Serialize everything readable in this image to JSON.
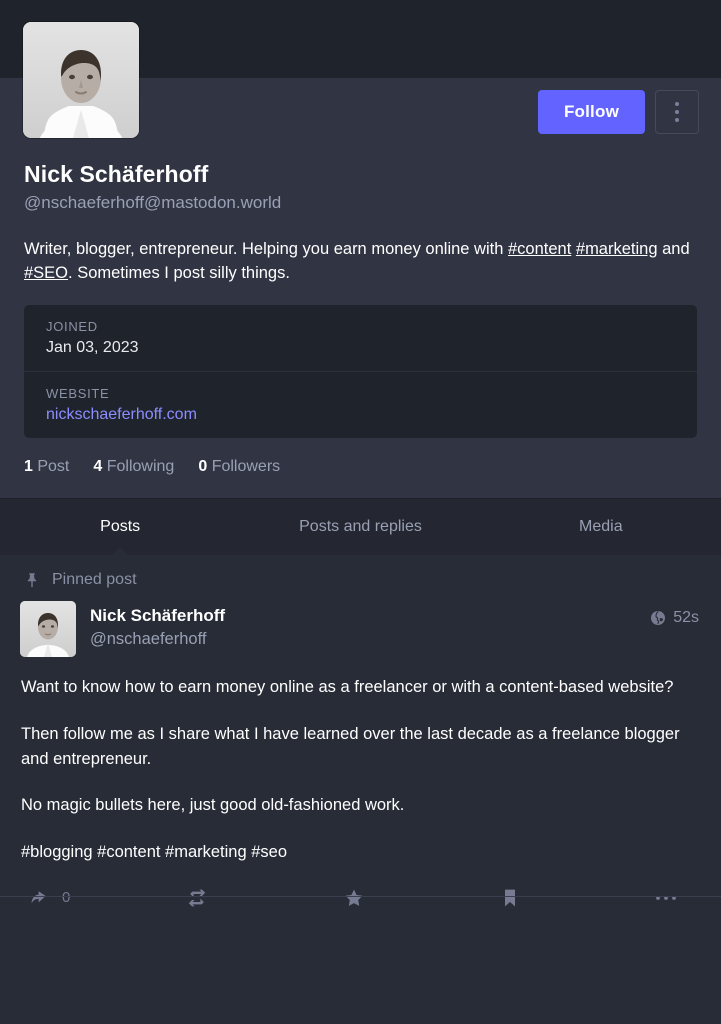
{
  "profile": {
    "avatar_alt": "profile-avatar",
    "display_name": "Nick Schäferhoff",
    "handle": "@nschaeferhoff@mastodon.world",
    "follow_label": "Follow",
    "menu_icon": "kebab-menu-icon",
    "bio_parts": [
      {
        "type": "text",
        "text": "Writer, blogger, entrepreneur. Helping you earn money online with "
      },
      {
        "type": "link",
        "text": "#content"
      },
      {
        "type": "text",
        "text": " "
      },
      {
        "type": "link",
        "text": "#marketing"
      },
      {
        "type": "text",
        "text": " and "
      },
      {
        "type": "link",
        "text": "#SEO"
      },
      {
        "type": "text",
        "text": ". Sometimes I post silly things."
      }
    ],
    "bio_plain": "Writer, blogger, entrepreneur. Helping you earn money online with #content #marketing and #SEO. Sometimes I post silly things.",
    "metadata": [
      {
        "label": "JOINED",
        "value": "Jan 03, 2023",
        "is_link": false
      },
      {
        "label": "WEBSITE",
        "value": "nickschaeferhoff.com",
        "is_link": true
      }
    ],
    "stats": [
      {
        "count": "1",
        "label": "Post"
      },
      {
        "count": "4",
        "label": "Following"
      },
      {
        "count": "0",
        "label": "Followers"
      }
    ],
    "accent_color": "#6364ff",
    "link_color": "#8c8dff"
  },
  "tabs": [
    {
      "label": "Posts",
      "active": true
    },
    {
      "label": "Posts and replies",
      "active": false
    },
    {
      "label": "Media",
      "active": false
    }
  ],
  "status": {
    "pinned_label": "Pinned post",
    "pin_icon": "pin-icon",
    "author_name": "Nick Schäferhoff",
    "author_handle": "@nschaeferhoff",
    "visibility_icon": "globe-icon",
    "timestamp": "52s",
    "paragraphs": [
      "Want to know how to earn money online as a freelancer or with a content-based website?",
      "Then follow me as I share what I have learned over the last decade as a freelance blogger and entrepreneur.",
      "No magic bullets here, just good old-fashioned work.",
      "#blogging #content #marketing #seo"
    ],
    "actions": [
      {
        "icon": "reply-icon",
        "count": "0"
      },
      {
        "icon": "boost-icon",
        "count": ""
      },
      {
        "icon": "favourite-star-icon",
        "count": ""
      },
      {
        "icon": "bookmark-icon",
        "count": ""
      },
      {
        "icon": "more-horizontal-icon",
        "count": ""
      }
    ]
  }
}
